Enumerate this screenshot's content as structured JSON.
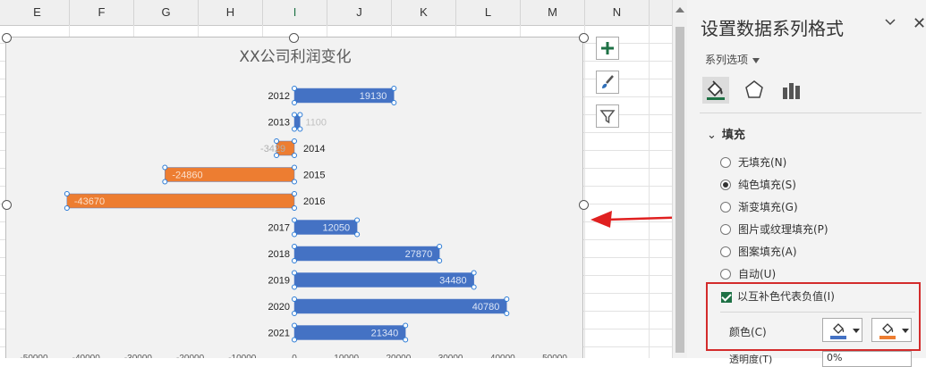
{
  "sheet": {
    "columns": [
      "E",
      "F",
      "G",
      "H",
      "I",
      "J",
      "K",
      "L",
      "M",
      "N"
    ],
    "selected_column": "I"
  },
  "chart_data": {
    "type": "bar",
    "title": "XX公司利润变化",
    "categories": [
      "2012",
      "2013",
      "2014",
      "2015",
      "2016",
      "2017",
      "2018",
      "2019",
      "2020",
      "2021"
    ],
    "values": [
      19130,
      1100,
      -3429,
      -24860,
      -43670,
      12050,
      27870,
      34480,
      40780,
      21340
    ],
    "value_labels": [
      "19130",
      "1100",
      "-3429",
      "-24860",
      "-43670",
      "12050",
      "27870",
      "34480",
      "40780",
      "21340"
    ],
    "xlim": [
      -50000,
      50000
    ],
    "x_ticks": [
      "-50000",
      "-40000",
      "-30000",
      "-20000",
      "-10000",
      "0",
      "10000",
      "20000",
      "30000",
      "40000",
      "50000"
    ],
    "orientation": "horizontal",
    "positive_color": "#4472C4",
    "negative_color": "#ED7D31",
    "legend": "none"
  },
  "chart_buttons": [
    {
      "name": "chart-elements-button",
      "icon": "plus-icon"
    },
    {
      "name": "chart-styles-button",
      "icon": "brush-icon"
    },
    {
      "name": "chart-filters-button",
      "icon": "filter-icon"
    }
  ],
  "pane": {
    "title": "设置数据系列格式",
    "series_options_label": "系列选项",
    "tabs": [
      "fill-line-icon",
      "effects-icon",
      "series-options-icon"
    ],
    "section_fill": "填充",
    "fill_options": [
      {
        "label": "无填充(N)",
        "selected": false
      },
      {
        "label": "纯色填充(S)",
        "selected": true
      },
      {
        "label": "渐变填充(G)",
        "selected": false
      },
      {
        "label": "图片或纹理填充(P)",
        "selected": false
      },
      {
        "label": "图案填充(A)",
        "selected": false
      },
      {
        "label": "自动(U)",
        "selected": false
      }
    ],
    "invert_label": "以互补色代表负值(I)",
    "invert_checked": true,
    "color_label": "颜色(C)",
    "primary_color": "#4472C4",
    "invert_color": "#ED7D31",
    "transparency_label": "透明度(T)",
    "transparency_value": "0%"
  }
}
